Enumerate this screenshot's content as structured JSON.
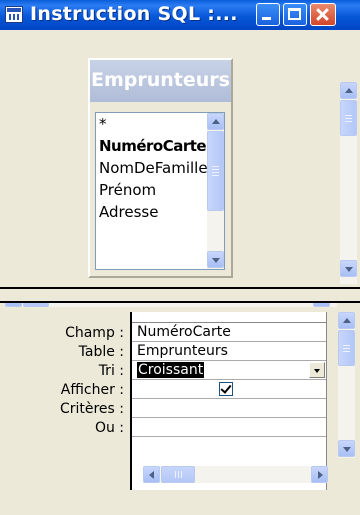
{
  "window": {
    "title": "Instruction SQL :...",
    "buttons": [
      "minimize",
      "maximize",
      "close"
    ]
  },
  "table_box": {
    "title": "Emprunteurs",
    "fields": [
      "*",
      "NuméroCarte",
      "NomDeFamille",
      "Prénom",
      "Adresse"
    ],
    "bold_field": "NuméroCarte"
  },
  "grid": {
    "row_labels": [
      "Champ :",
      "Table :",
      "Tri :",
      "Afficher :",
      "Critères :",
      "Ou :"
    ],
    "column": {
      "champ": "NuméroCarte",
      "table": "Emprunteurs",
      "tri": "Croissant",
      "afficher": true,
      "criteres": "",
      "ou": ""
    }
  },
  "colors": {
    "titlebar": "#0758d8",
    "close_button": "#d2462a",
    "window_bg": "#ece9d8"
  }
}
